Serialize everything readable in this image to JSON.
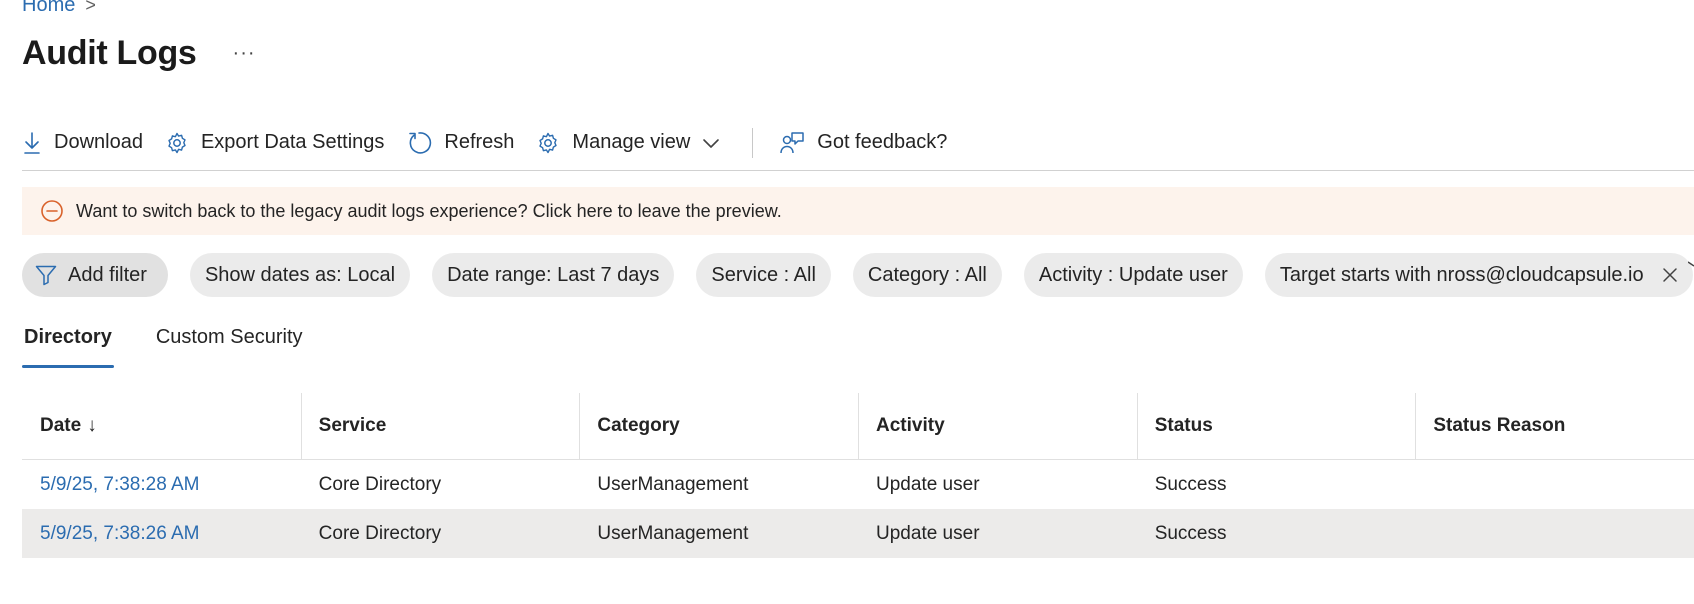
{
  "breadcrumb": {
    "home": "Home",
    "separator": ">"
  },
  "page": {
    "title": "Audit Logs",
    "more": "···"
  },
  "toolbar": {
    "download": "Download",
    "export_settings": "Export Data Settings",
    "refresh": "Refresh",
    "manage_view": "Manage view",
    "feedback": "Got feedback?"
  },
  "banner": {
    "text": "Want to switch back to the legacy audit logs experience? Click here to leave the preview."
  },
  "filters": {
    "add": "Add filter",
    "dates": "Show dates as: Local",
    "range": "Date range: Last 7 days",
    "service": "Service : All",
    "category": "Category : All",
    "activity": "Activity : Update user",
    "target": "Target starts with nross@cloudcapsule.io"
  },
  "tabs": {
    "directory": "Directory",
    "custom_security": "Custom Security"
  },
  "table": {
    "headers": {
      "date": "Date",
      "date_sort": "↓",
      "service": "Service",
      "category": "Category",
      "activity": "Activity",
      "status": "Status",
      "status_reason": "Status Reason"
    },
    "rows": [
      {
        "date": "5/9/25, 7:38:28 AM",
        "service": "Core Directory",
        "category": "UserManagement",
        "activity": "Update user",
        "status": "Success",
        "status_reason": ""
      },
      {
        "date": "5/9/25, 7:38:26 AM",
        "service": "Core Directory",
        "category": "UserManagement",
        "activity": "Update user",
        "status": "Success",
        "status_reason": ""
      }
    ]
  },
  "colors": {
    "accent": "#2b6cb0",
    "banner_bg": "#fdf3ec",
    "warning_icon": "#d9622b",
    "selected_row": "#ecebea"
  }
}
